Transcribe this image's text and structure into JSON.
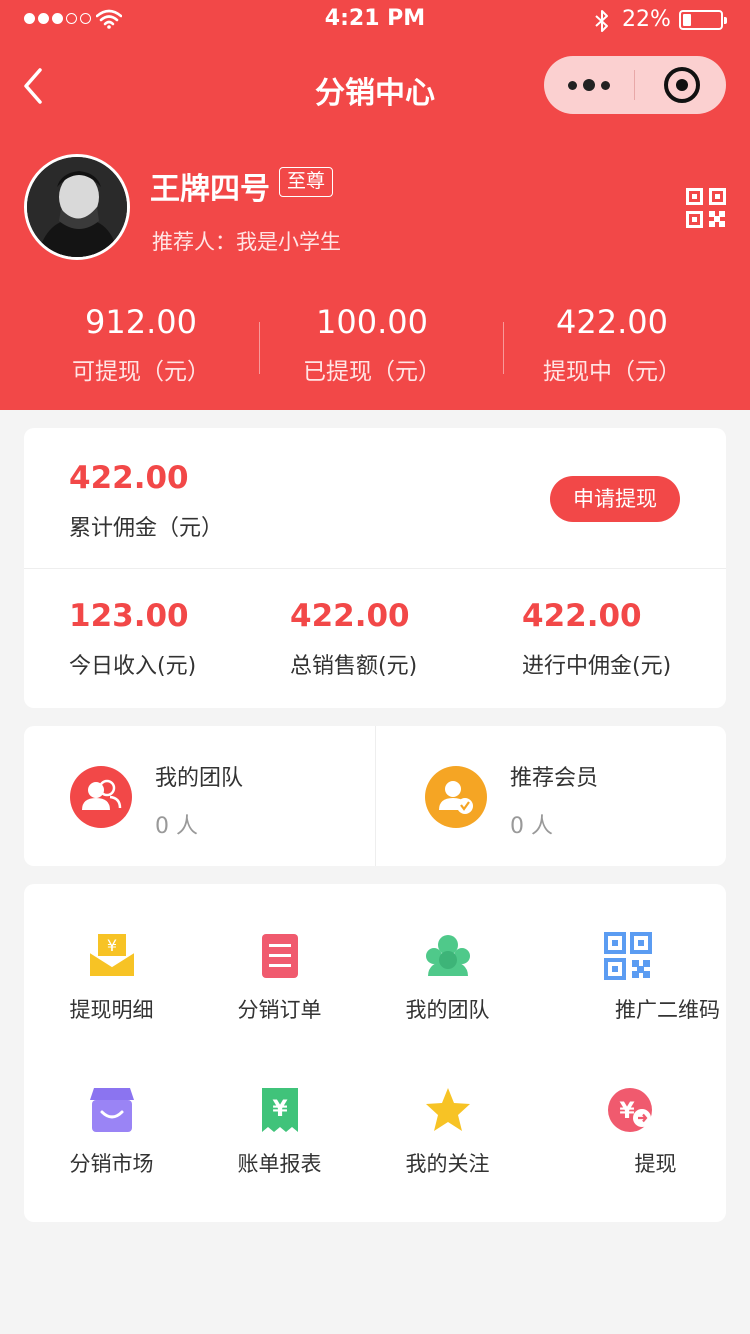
{
  "status_bar": {
    "time": "4:21 PM",
    "battery": "22%"
  },
  "nav": {
    "title": "分销中心"
  },
  "profile": {
    "name": "王牌四号",
    "level_badge": "至尊",
    "referrer": "推荐人：我是小学生"
  },
  "header_stats": [
    {
      "value": "912.00",
      "label": "可提现（元）"
    },
    {
      "value": "100.00",
      "label": "已提现（元）"
    },
    {
      "value": "422.00",
      "label": "提现中（元）"
    }
  ],
  "commission": {
    "total_value": "422.00",
    "total_label": "累计佣金（元）",
    "apply_button": "申请提现",
    "stats": [
      {
        "value": "123.00",
        "label": "今日收入(元)"
      },
      {
        "value": "422.00",
        "label": "总销售额(元)"
      },
      {
        "value": "422.00",
        "label": "进行中佣金(元)"
      }
    ]
  },
  "team": [
    {
      "title": "我的团队",
      "count": "0 人",
      "icon": "team-icon",
      "color": "#f24848"
    },
    {
      "title": "推荐会员",
      "count": "0 人",
      "icon": "member-icon",
      "color": "#f5a524"
    }
  ],
  "menu": [
    {
      "label": "提现明细",
      "icon": "withdraw-detail-icon",
      "color": "#f7c325"
    },
    {
      "label": "分销订单",
      "icon": "order-list-icon",
      "color": "#f05a6e"
    },
    {
      "label": "我的团队",
      "icon": "team-group-icon",
      "color": "#4fc98a"
    },
    {
      "label": "推广二维码",
      "icon": "qr-code-icon",
      "color": "#5b9cf2"
    },
    {
      "label": "分销市场",
      "icon": "market-icon",
      "color": "#9a84f5"
    },
    {
      "label": "账单报表",
      "icon": "bill-icon",
      "color": "#40c37a"
    },
    {
      "label": "我的关注",
      "icon": "star-icon",
      "color": "#f7c325"
    },
    {
      "label": "提现",
      "icon": "withdraw-icon",
      "color": "#f05a6e"
    }
  ]
}
